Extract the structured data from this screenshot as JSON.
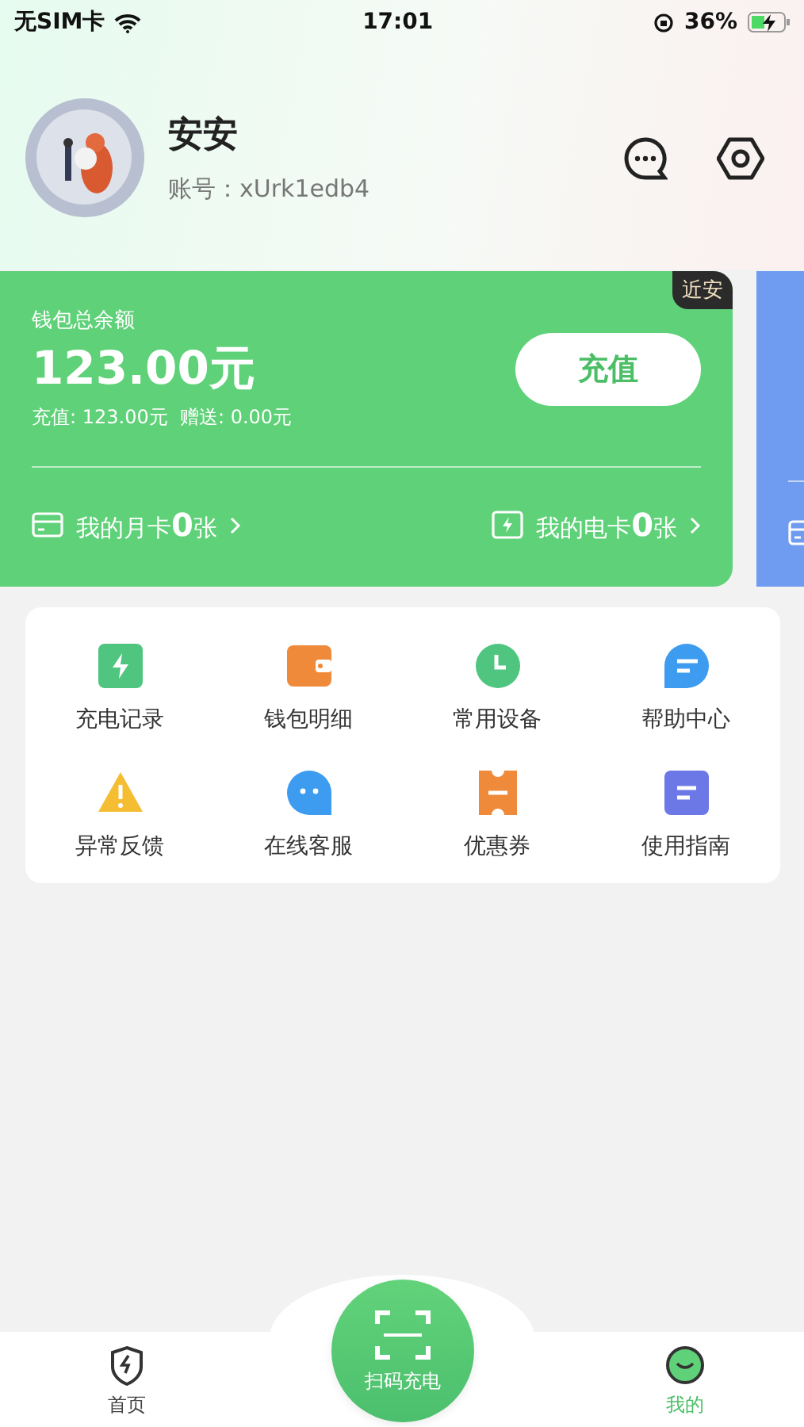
{
  "status_bar": {
    "carrier": "无SIM卡",
    "time": "17:01",
    "battery": "36%"
  },
  "profile": {
    "name": "安安",
    "account": "账号：xUrk1edb4"
  },
  "wallet_cards": [
    {
      "color": "#5fd178",
      "tag": "近安",
      "title": "钱包总余额",
      "amount": "123.00元",
      "detail": "充值: 123.00元  赠送: 0.00元",
      "button": "充值",
      "links": [
        "我的月卡**0**张",
        "我的电卡**0**张"
      ]
    },
    {
      "color": "#6f9cf0"
    }
  ],
  "menu": [
    {
      "kind": "bolt",
      "label": "充电记录"
    },
    {
      "kind": "wallet",
      "label": "钱包明细"
    },
    {
      "kind": "clock",
      "label": "常用设备"
    },
    {
      "kind": "help",
      "label": "帮助中心"
    },
    {
      "kind": "warning",
      "label": "异常反馈"
    },
    {
      "kind": "chat",
      "label": "在线客服"
    },
    {
      "kind": "coupon",
      "label": "优惠券"
    },
    {
      "kind": "guide",
      "label": "使用指南"
    }
  ],
  "tab_bar": {
    "tabs": [
      {
        "label": "首页",
        "selected": false
      },
      {
        "label": "我的",
        "selected": true
      }
    ],
    "scan_button": "扫码充电"
  }
}
